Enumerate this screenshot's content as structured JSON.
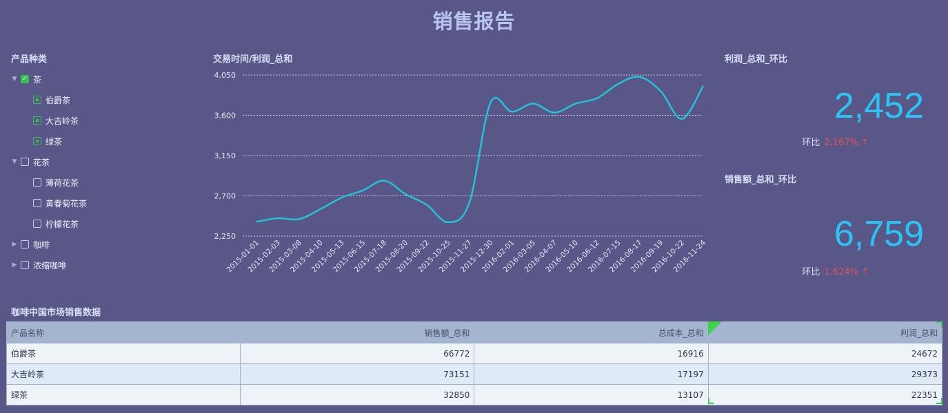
{
  "page": {
    "title": "销售报告"
  },
  "filter": {
    "title": "产品种类",
    "items": [
      {
        "label": "茶",
        "level": 0,
        "state": "checked",
        "expanded": true
      },
      {
        "label": "伯爵茶",
        "level": 1,
        "state": "partial"
      },
      {
        "label": "大吉岭茶",
        "level": 1,
        "state": "partial"
      },
      {
        "label": "绿茶",
        "level": 1,
        "state": "partial"
      },
      {
        "label": "花茶",
        "level": 0,
        "state": "unchecked",
        "expanded": true
      },
      {
        "label": "薄荷花茶",
        "level": 1,
        "state": "unchecked"
      },
      {
        "label": "黄春菊花茶",
        "level": 1,
        "state": "unchecked"
      },
      {
        "label": "柠檬花茶",
        "level": 1,
        "state": "unchecked"
      },
      {
        "label": "咖啡",
        "level": 0,
        "state": "unchecked",
        "expanded": false
      },
      {
        "label": "浓缩咖啡",
        "level": 0,
        "state": "unchecked",
        "expanded": false
      }
    ]
  },
  "chart_data": {
    "type": "line",
    "title": "交易时间/利润_总和",
    "x": [
      "2015-01-01",
      "2015-02-03",
      "2015-03-08",
      "2015-04-10",
      "2015-05-13",
      "2015-06-15",
      "2015-07-18",
      "2015-08-20",
      "2015-09-22",
      "2015-10-25",
      "2015-11-27",
      "2015-12-30",
      "2016-02-01",
      "2016-03-05",
      "2016-04-07",
      "2016-05-10",
      "2016-06-12",
      "2016-07-15",
      "2016-08-17",
      "2016-09-19",
      "2016-10-22",
      "2016-11-24"
    ],
    "y": [
      2410,
      2450,
      2440,
      2550,
      2680,
      2760,
      2870,
      2720,
      2600,
      2405,
      2620,
      3740,
      3640,
      3730,
      3630,
      3730,
      3790,
      3950,
      4030,
      3870,
      3560,
      3930
    ],
    "yticks": [
      "4,050",
      "3,600",
      "3,150",
      "2,700",
      "2,250"
    ],
    "ytick_values": [
      4050,
      3600,
      3150,
      2700,
      2250
    ],
    "ylim": [
      2250,
      4050
    ],
    "grid": true,
    "color": "#23c3d6"
  },
  "kpis": [
    {
      "title": "利润_总和_环比",
      "value": "2,452",
      "ratio_label": "环比",
      "ratio": "2.167% ↑"
    },
    {
      "title": "销售额_总和_环比",
      "value": "6,759",
      "ratio_label": "环比",
      "ratio": "1.624% ↑"
    }
  ],
  "table": {
    "title": "咖啡中国市场销售数据",
    "columns": [
      "产品名称",
      "销售额_总和",
      "总成本_总和",
      "利润_总和"
    ],
    "rows": [
      [
        "伯爵茶",
        "66772",
        "16916",
        "24672"
      ],
      [
        "大吉岭茶",
        "73151",
        "17197",
        "29373"
      ],
      [
        "绿茶",
        "32850",
        "13107",
        "22351"
      ]
    ]
  },
  "colors": {
    "background": "#595787",
    "accent": "#29c6f5",
    "negative": "#e0555b",
    "check": "#35c152"
  }
}
